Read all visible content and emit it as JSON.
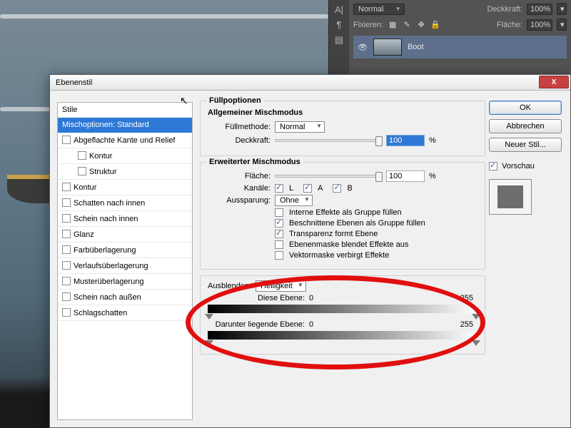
{
  "panel": {
    "blend": "Normal",
    "opacity_label": "Deckkraft:",
    "opacity": "100%",
    "fill_label": "Fläche:",
    "fill": "100%",
    "lock_label": "Fixieren:",
    "layer_name": "Boot"
  },
  "dialog": {
    "title": "Ebenenstil",
    "ok": "OK",
    "cancel": "Abbrechen",
    "new_style": "Neuer Stil...",
    "preview": "Vorschau"
  },
  "styles": {
    "header": "Stile",
    "items": [
      "Mischoptionen: Standard",
      "Abgeflachte Kante und Relief",
      "Kontur",
      "Struktur",
      "Kontur",
      "Schatten nach innen",
      "Schein nach innen",
      "Glanz",
      "Farbüberlagerung",
      "Verlaufsüberlagerung",
      "Musterüberlagerung",
      "Schein nach außen",
      "Schlagschatten"
    ]
  },
  "fill_options": {
    "legend": "Füllpoptionen",
    "general": "Allgemeiner Mischmodus",
    "method_label": "Füllmethode:",
    "method": "Normal",
    "opacity_label": "Deckkraft:",
    "opacity": "100",
    "pct": "%"
  },
  "advanced": {
    "legend": "Erweiterter Mischmodus",
    "fill_label": "Fläche:",
    "fill": "100",
    "pct": "%",
    "channels_label": "Kanäle:",
    "ch": [
      "L",
      "A",
      "B"
    ],
    "knockout_label": "Aussparung:",
    "knockout": "Ohne",
    "opts": [
      "Interne Effekte als Gruppe füllen",
      "Beschnittene Ebenen als Gruppe füllen",
      "Transparenz formt Ebene",
      "Ebenenmaske blendet Effekte aus",
      "Vektormaske verbirgt Effekte"
    ],
    "opts_on": [
      false,
      true,
      true,
      false,
      false
    ]
  },
  "blendif": {
    "legend": "Ausblenden:",
    "mode": "Helligkeit",
    "this": "Diese Ebene:",
    "under": "Darunter liegende Ebene:",
    "v0": "0",
    "v1": "255"
  }
}
